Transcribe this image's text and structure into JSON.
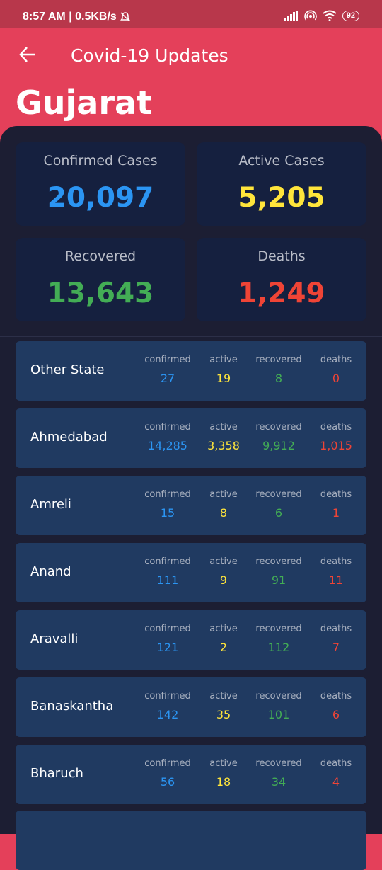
{
  "status_bar": {
    "time_speed": "8:57 AM | 0.5KB/s",
    "battery": "92"
  },
  "app_bar": {
    "title": "Covid-19 Updates"
  },
  "state": "Gujarat",
  "summary": {
    "confirmed": {
      "label": "Confirmed Cases",
      "value": "20,097"
    },
    "active": {
      "label": "Active Cases",
      "value": "5,205"
    },
    "recovered": {
      "label": "Recovered",
      "value": "13,643"
    },
    "deaths": {
      "label": "Deaths",
      "value": "1,249"
    }
  },
  "column_headers": {
    "confirmed": "confirmed",
    "active": "active",
    "recovered": "recovered",
    "deaths": "deaths"
  },
  "districts": [
    {
      "name": "Other State",
      "confirmed": "27",
      "active": "19",
      "recovered": "8",
      "deaths": "0"
    },
    {
      "name": "Ahmedabad",
      "confirmed": "14,285",
      "active": "3,358",
      "recovered": "9,912",
      "deaths": "1,015"
    },
    {
      "name": "Amreli",
      "confirmed": "15",
      "active": "8",
      "recovered": "6",
      "deaths": "1"
    },
    {
      "name": "Anand",
      "confirmed": "111",
      "active": "9",
      "recovered": "91",
      "deaths": "11"
    },
    {
      "name": "Aravalli",
      "confirmed": "121",
      "active": "2",
      "recovered": "112",
      "deaths": "7"
    },
    {
      "name": "Banaskantha",
      "confirmed": "142",
      "active": "35",
      "recovered": "101",
      "deaths": "6"
    },
    {
      "name": "Bharuch",
      "confirmed": "56",
      "active": "18",
      "recovered": "34",
      "deaths": "4"
    }
  ],
  "colors": {
    "confirmed": "#2b95f3",
    "active": "#ffe53b",
    "recovered": "#43ad55",
    "deaths": "#ef4436",
    "header": "#e4405a"
  }
}
